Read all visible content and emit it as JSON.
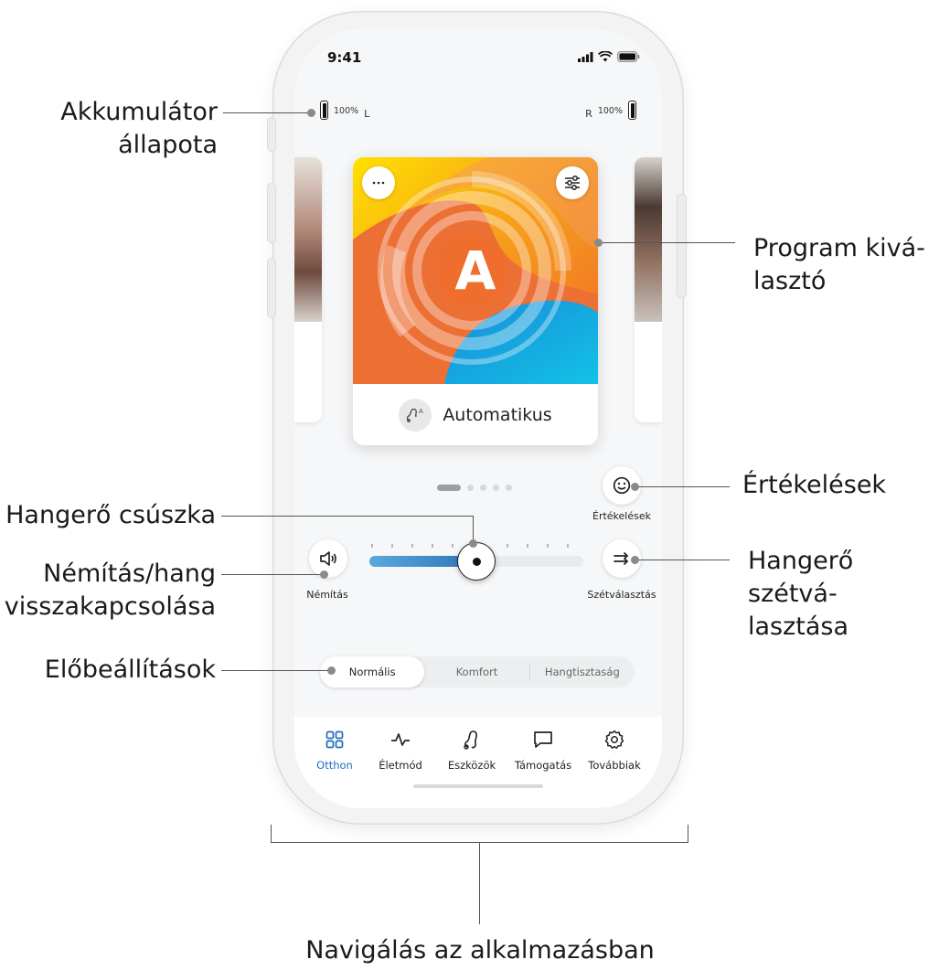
{
  "callouts": {
    "battery": [
      "Akkumulátor",
      "állapota"
    ],
    "program": [
      "Program kivá-",
      "lasztó"
    ],
    "ratings": "Értékelések",
    "volume_slider": "Hangerő csúszka",
    "mute": [
      "Némítás/hang",
      "visszakapcsolása"
    ],
    "split": [
      "Hangerő szétvá-",
      "lasztása"
    ],
    "presets": "Előbeállítások",
    "navigation": "Navigálás az alkalmazásban"
  },
  "status_bar": {
    "time": "9:41"
  },
  "battery": {
    "left": {
      "percent": "100%",
      "side": "L"
    },
    "right": {
      "percent": "100%",
      "side": "R"
    }
  },
  "program_card": {
    "letter": "A",
    "name": "Automatikus",
    "menu_icon": "ellipsis-icon",
    "settings_icon": "sliders-icon",
    "program_icon": "hearing-aid-auto-icon"
  },
  "pager": {
    "count": 5,
    "active": 0
  },
  "ratings_button": {
    "label": "Értékelések",
    "icon": "smiley-icon"
  },
  "mute_button": {
    "label": "Némítás",
    "icon": "speaker-icon"
  },
  "split_button": {
    "label": "Szétválasztás",
    "icon": "split-arrows-icon"
  },
  "volume": {
    "level": 0.5
  },
  "presets": {
    "options": [
      "Normális",
      "Komfort",
      "Hangtisztaság"
    ],
    "selected": "Normális"
  },
  "tabs": [
    {
      "label": "Otthon",
      "icon": "grid-icon",
      "active": true
    },
    {
      "label": "Életmód",
      "icon": "pulse-icon",
      "active": false
    },
    {
      "label": "Eszközök",
      "icon": "hearing-aid-icon",
      "active": false
    },
    {
      "label": "Támogatás",
      "icon": "chat-icon",
      "active": false
    },
    {
      "label": "Továbbiak",
      "icon": "gear-icon",
      "active": false
    }
  ],
  "colors": {
    "accent": "#1f6fbf",
    "slider_fill": "#3f8fcf"
  }
}
